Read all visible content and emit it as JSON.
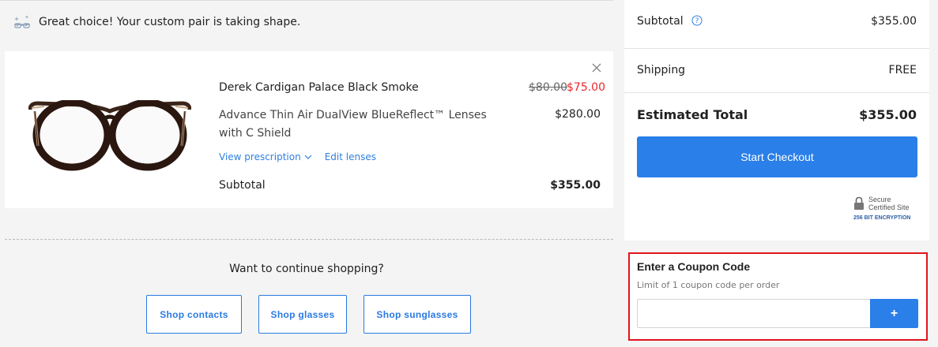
{
  "banner": {
    "message": "Great choice! Your custom pair is taking shape.",
    "icon": "glasses-sparkle-icon"
  },
  "cart_item": {
    "product_name": "Derek Cardigan Palace Black Smoke",
    "price_original": "$80.00",
    "price_sale": "$75.00",
    "lens_name": "Advance Thin Air DualView BlueReflect™ Lenses with C Shield",
    "lens_price": "$280.00",
    "view_prescription_label": "View prescription",
    "edit_lenses_label": "Edit lenses",
    "subtotal_label": "Subtotal",
    "subtotal_value": "$355.00"
  },
  "continue_shopping": {
    "prompt": "Want to continue shopping?",
    "buttons": [
      "Shop contacts",
      "Shop glasses",
      "Shop sunglasses"
    ]
  },
  "summary": {
    "subtotal_label": "Subtotal",
    "subtotal_value": "$355.00",
    "shipping_label": "Shipping",
    "shipping_value": "FREE",
    "estimated_total_label": "Estimated Total",
    "estimated_total_value": "$355.00",
    "checkout_label": "Start Checkout",
    "secure_badge": {
      "line1": "Secure",
      "line2": "Certified Site",
      "line3": "256 BIT ENCRYPTION"
    }
  },
  "coupon": {
    "title": "Enter a Coupon Code",
    "subtitle": "Limit of 1 coupon code per order",
    "input_value": "",
    "add_button_label": "+"
  },
  "colors": {
    "accent_blue": "#2a7fe8",
    "sale_red": "#e8262b",
    "highlight_border": "#e0141e"
  }
}
